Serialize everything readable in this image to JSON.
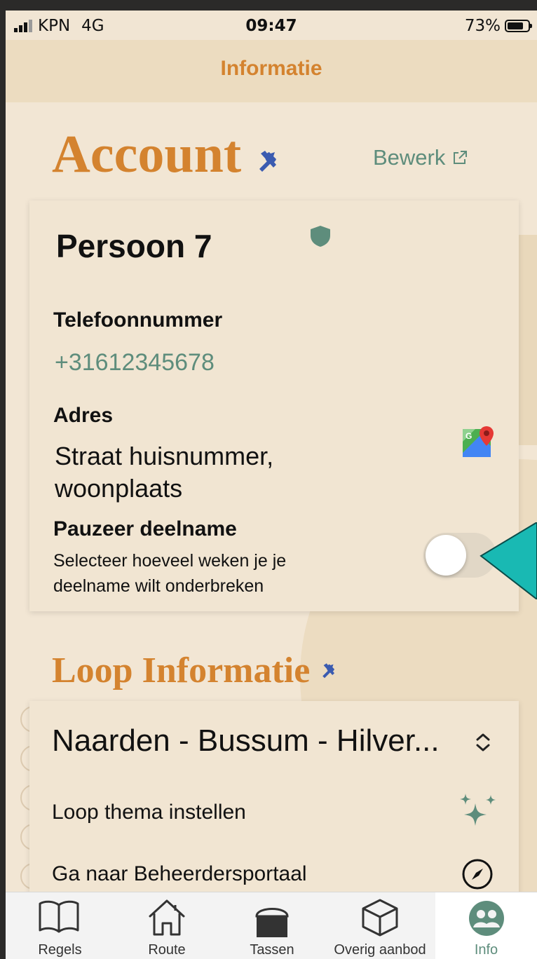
{
  "status_bar": {
    "carrier": "KPN",
    "network": "4G",
    "time": "09:47",
    "battery": "73%"
  },
  "header": {
    "title": "Informatie"
  },
  "account": {
    "title": "Account",
    "edit_label": "Bewerk",
    "name": "Persoon 7",
    "phone_label": "Telefoonnummer",
    "phone_value": "+31612345678",
    "address_label": "Adres",
    "address_line1": "Straat huisnummer,",
    "address_line2": "woonplaats",
    "pause_title": "Pauzeer deelname",
    "pause_desc_line1": "Selecteer hoeveel weken je je",
    "pause_desc_line2": "deelname wilt onderbreken",
    "pause_enabled": false
  },
  "loop": {
    "title": "Loop Informatie",
    "route_name": "Naarden - Bussum - Hilver...",
    "theme_label": "Loop thema instellen",
    "portal_label": "Ga naar Beheerdersportaal"
  },
  "tabs": [
    {
      "label": "Regels",
      "icon": "book-icon"
    },
    {
      "label": "Route",
      "icon": "house-icon"
    },
    {
      "label": "Tassen",
      "icon": "bag-icon"
    },
    {
      "label": "Overig aanbod",
      "icon": "cube-icon"
    },
    {
      "label": "Info",
      "icon": "people-icon",
      "active": true
    }
  ],
  "colors": {
    "accent": "#d4832f",
    "green": "#5e8d7c",
    "tool_blue": "#3b5bb0",
    "background": "#f2e6d4"
  }
}
